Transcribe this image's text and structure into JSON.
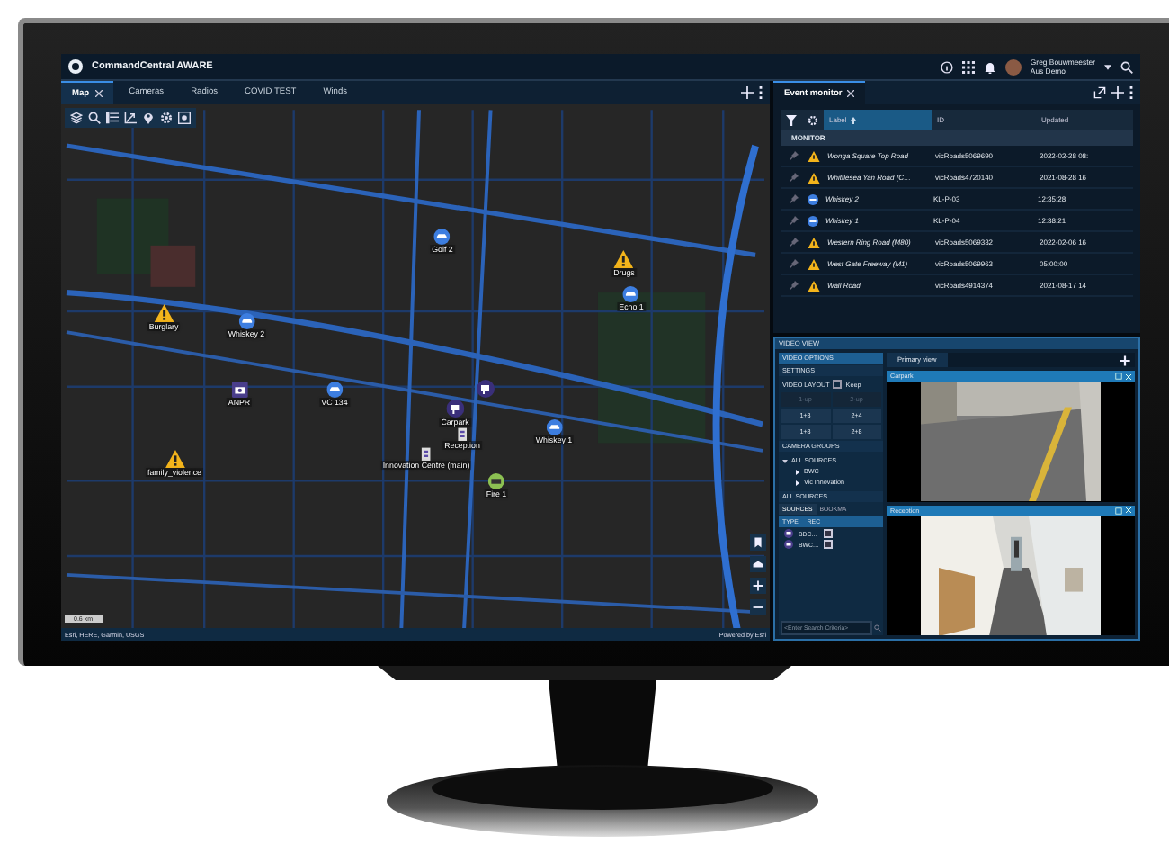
{
  "app": {
    "title": "CommandCentral AWARE",
    "user": {
      "name": "Greg Bouwmeester",
      "org": "Aus Demo"
    }
  },
  "tabs": [
    {
      "label": "Map",
      "selected": true,
      "closable": true
    },
    {
      "label": "Cameras",
      "selected": false,
      "closable": false
    },
    {
      "label": "Radios",
      "selected": false,
      "closable": false
    },
    {
      "label": "COVID TEST",
      "selected": false,
      "closable": false
    },
    {
      "label": "Winds",
      "selected": false,
      "closable": false
    }
  ],
  "map": {
    "markers": [
      {
        "kind": "unit",
        "label": "Golf 2"
      },
      {
        "kind": "incident",
        "label": "Drugs"
      },
      {
        "kind": "unit",
        "label": "Echo 1"
      },
      {
        "kind": "incident",
        "label": "Burglary"
      },
      {
        "kind": "unit",
        "label": "Whiskey 2"
      },
      {
        "kind": "anpr",
        "label": "ANPR"
      },
      {
        "kind": "unit",
        "label": "VC 134"
      },
      {
        "kind": "camera"
      },
      {
        "kind": "camera",
        "label": "Carpark"
      },
      {
        "kind": "site",
        "label": "Reception"
      },
      {
        "kind": "site",
        "label": "Innovation Centre (main)"
      },
      {
        "kind": "fire",
        "label": "Fire 1"
      },
      {
        "kind": "unit",
        "label": "Whiskey 1"
      },
      {
        "kind": "incident",
        "label": "family_violence"
      }
    ],
    "scale": "0.6 km",
    "attribution": "Esri, HERE, Garmin, USGS",
    "powered_by": "Powered by Esri"
  },
  "event_monitor": {
    "tab": {
      "label": "Event monitor",
      "selected": true
    },
    "columns": [
      {
        "label": "Label",
        "sorted": true
      },
      {
        "label": "ID",
        "sorted": false
      },
      {
        "label": "Updated",
        "sorted": false
      }
    ],
    "group": "MONITOR",
    "rows": [
      {
        "kind": "incident",
        "label": "Wonga Square Top Road",
        "id": "vicRoads5069690",
        "updated": "2022-02-28 08:"
      },
      {
        "kind": "incident",
        "label": "Whittlesea Yan Road (C…",
        "id": "vicRoads4720140",
        "updated": "2021-08-28 16"
      },
      {
        "kind": "unit",
        "label": "Whiskey 2",
        "id": "KL-P-03",
        "updated": "12:35:28"
      },
      {
        "kind": "unit",
        "label": "Whiskey 1",
        "id": "KL-P-04",
        "updated": "12:38:21"
      },
      {
        "kind": "incident",
        "label": "Western Ring Road (M80)",
        "id": "vicRoads5069332",
        "updated": "2022-02-06 16"
      },
      {
        "kind": "incident",
        "label": "West Gate Freeway (M1)",
        "id": "vicRoads5069963",
        "updated": "05:00:00"
      },
      {
        "kind": "incident",
        "label": "Wall Road",
        "id": "vicRoads4914374",
        "updated": "2021-08-17 14"
      }
    ]
  },
  "video_view": {
    "title": "VIDEO VIEW",
    "options_title": "VIDEO OPTIONS",
    "settings": "SETTINGS",
    "layout": {
      "title": "VIDEO LAYOUT",
      "keep": {
        "label": "Keep",
        "checked": false
      },
      "buttons": [
        {
          "label": "1-up",
          "disabled": true
        },
        {
          "label": "2-up",
          "disabled": true
        },
        {
          "label": "1+3",
          "disabled": false
        },
        {
          "label": "2+4",
          "disabled": false
        },
        {
          "label": "1+8",
          "disabled": false
        },
        {
          "label": "2+8",
          "disabled": false
        }
      ]
    },
    "camera_groups": {
      "title": "CAMERA GROUPS",
      "tree": [
        {
          "label": "ALL SOURCES",
          "expanded": true,
          "children": [
            {
              "label": "BWC",
              "expanded": false
            },
            {
              "label": "Vic Innovation",
              "expanded": false
            }
          ]
        }
      ]
    },
    "sources": {
      "title": "ALL SOURCES",
      "tabs": [
        {
          "label": "SOURCES",
          "selected": true
        },
        {
          "label": "BOOKMA",
          "selected": false
        }
      ],
      "columns": [
        "TYPE",
        "REC"
      ],
      "rows": [
        "BDC…",
        "BWC…"
      ],
      "search": {
        "placeholder": "<Enter Search Criteria>"
      }
    },
    "view_tab": {
      "label": "Primary view",
      "selected": true
    },
    "tiles": [
      {
        "label": "Carpark",
        "kind": "picture"
      },
      {
        "label": "Reception",
        "kind": "picture"
      }
    ]
  }
}
